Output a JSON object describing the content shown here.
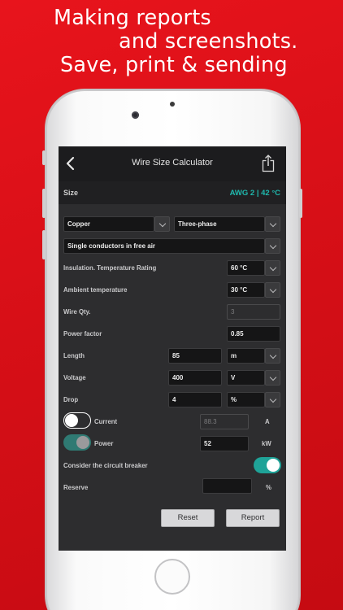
{
  "headline": {
    "line1": "Making reports",
    "line2": "and screenshots.",
    "line3": "Save, print & sending"
  },
  "nav": {
    "title": "Wire Size Calculator",
    "back_icon": "chevron-left-icon",
    "share_icon": "share-icon"
  },
  "size": {
    "label": "Size",
    "value": "AWG 2 | 42 °C"
  },
  "selectors": {
    "material": "Copper",
    "phase": "Three-phase",
    "installation": "Single conductors in free air"
  },
  "rows": {
    "insulation_label": "Insulation. Temperature Rating",
    "insulation_value": "60 °C",
    "ambient_label": "Ambient temperature",
    "ambient_value": "30 °C",
    "wire_qty_label": "Wire Qty.",
    "wire_qty_value": "3",
    "power_factor_label": "Power factor",
    "power_factor_value": "0.85",
    "length_label": "Length",
    "length_value": "85",
    "length_unit": "m",
    "voltage_label": "Voltage",
    "voltage_value": "400",
    "voltage_unit": "V",
    "drop_label": "Drop",
    "drop_value": "4",
    "drop_unit": "%",
    "current_label": "Current",
    "current_value": "88.3",
    "current_unit": "A",
    "power_label": "Power",
    "power_value": "52",
    "power_unit": "kW",
    "breaker_label": "Consider the circuit breaker",
    "reserve_label": "Reserve",
    "reserve_value": "",
    "reserve_unit": "%"
  },
  "buttons": {
    "reset": "Reset",
    "report": "Report"
  },
  "colors": {
    "background_red": "#d70f17",
    "accent_teal": "#1fb8ad"
  }
}
